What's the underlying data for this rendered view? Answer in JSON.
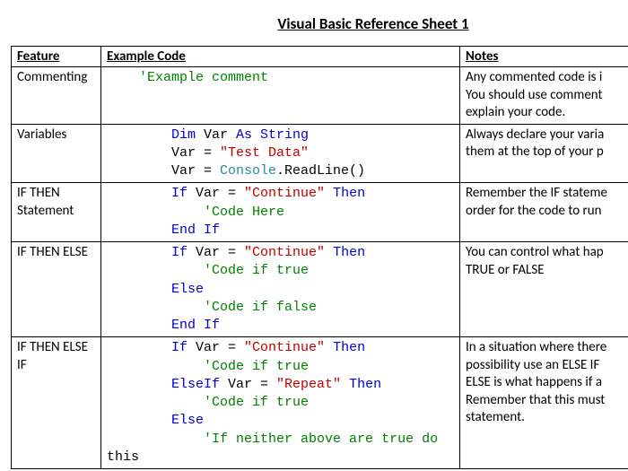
{
  "title": "Visual Basic Reference Sheet 1",
  "headers": {
    "feature": "Feature",
    "example": "Example Code",
    "notes": "Notes"
  },
  "rows": [
    {
      "feature": "Commenting",
      "code": [
        {
          "indent": 4,
          "spans": [
            {
              "cls": "com",
              "t": "'Example comment"
            }
          ]
        }
      ],
      "notes": "Any commented code is i  You should use comment  explain your code."
    },
    {
      "feature": "Variables",
      "code": [
        {
          "indent": 8,
          "spans": [
            {
              "cls": "kw",
              "t": "Dim"
            },
            {
              "cls": "",
              "t": " Var "
            },
            {
              "cls": "kw",
              "t": "As String"
            }
          ]
        },
        {
          "indent": 8,
          "spans": [
            {
              "cls": "",
              "t": "Var = "
            },
            {
              "cls": "str",
              "t": "\"Test Data\""
            }
          ]
        },
        {
          "indent": 8,
          "spans": [
            {
              "cls": "",
              "t": "Var = "
            },
            {
              "cls": "cls",
              "t": "Console"
            },
            {
              "cls": "",
              "t": ".ReadLine()"
            }
          ]
        }
      ],
      "notes": "Always declare your varia  them at the top of your p"
    },
    {
      "feature": "IF THEN Statement",
      "code": [
        {
          "indent": 8,
          "spans": [
            {
              "cls": "kw",
              "t": "If"
            },
            {
              "cls": "",
              "t": " Var = "
            },
            {
              "cls": "str",
              "t": "\"Continue\""
            },
            {
              "cls": "",
              "t": " "
            },
            {
              "cls": "kw",
              "t": "Then"
            }
          ]
        },
        {
          "indent": 12,
          "spans": [
            {
              "cls": "com",
              "t": "'Code Here"
            }
          ]
        },
        {
          "indent": 8,
          "spans": [
            {
              "cls": "kw",
              "t": "End If"
            }
          ]
        }
      ],
      "notes": "Remember the IF stateme  order for the code to run"
    },
    {
      "feature": "IF THEN ELSE",
      "code": [
        {
          "indent": 8,
          "spans": [
            {
              "cls": "kw",
              "t": "If"
            },
            {
              "cls": "",
              "t": " Var = "
            },
            {
              "cls": "str",
              "t": "\"Continue\""
            },
            {
              "cls": "",
              "t": " "
            },
            {
              "cls": "kw",
              "t": "Then"
            }
          ]
        },
        {
          "indent": 12,
          "spans": [
            {
              "cls": "com",
              "t": "'Code if true"
            }
          ]
        },
        {
          "indent": 8,
          "spans": [
            {
              "cls": "kw",
              "t": "Else"
            }
          ]
        },
        {
          "indent": 12,
          "spans": [
            {
              "cls": "com",
              "t": "'Code if false"
            }
          ]
        },
        {
          "indent": 8,
          "spans": [
            {
              "cls": "kw",
              "t": "End If"
            }
          ]
        }
      ],
      "notes": "You can control what hap  TRUE or FALSE"
    },
    {
      "feature": "IF THEN ELSE IF",
      "code": [
        {
          "indent": 8,
          "spans": [
            {
              "cls": "kw",
              "t": "If"
            },
            {
              "cls": "",
              "t": " Var = "
            },
            {
              "cls": "str",
              "t": "\"Continue\""
            },
            {
              "cls": "",
              "t": " "
            },
            {
              "cls": "kw",
              "t": "Then"
            }
          ]
        },
        {
          "indent": 12,
          "spans": [
            {
              "cls": "com",
              "t": "'Code if true"
            }
          ]
        },
        {
          "indent": 8,
          "spans": [
            {
              "cls": "kw",
              "t": "ElseIf"
            },
            {
              "cls": "",
              "t": " Var = "
            },
            {
              "cls": "str",
              "t": "\"Repeat\""
            },
            {
              "cls": "",
              "t": " "
            },
            {
              "cls": "kw",
              "t": "Then"
            }
          ]
        },
        {
          "indent": 12,
          "spans": [
            {
              "cls": "com",
              "t": "'Code if true"
            }
          ]
        },
        {
          "indent": 8,
          "spans": [
            {
              "cls": "kw",
              "t": "Else"
            }
          ]
        },
        {
          "indent": 12,
          "spans": [
            {
              "cls": "com",
              "t": "'If neither above are true do"
            }
          ]
        },
        {
          "indent": 0,
          "spans": [
            {
              "cls": "",
              "t": "this"
            }
          ]
        }
      ],
      "notes": "In a situation where there  possibility use an ELSE IF  ELSE is what happens if a  Remember that this must  statement."
    }
  ]
}
